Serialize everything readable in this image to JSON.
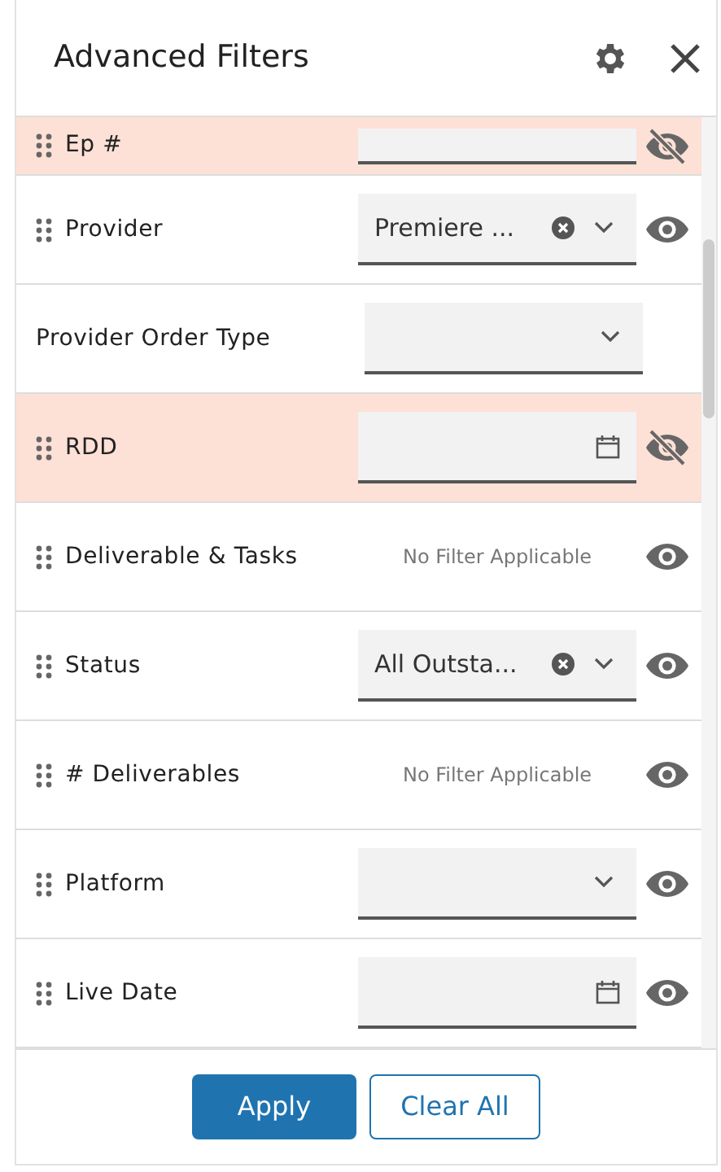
{
  "panel": {
    "title": "Advanced Filters"
  },
  "filters": [
    {
      "label": "Ep #",
      "draggable": true,
      "kind": "text",
      "hidden": true
    },
    {
      "label": "Provider",
      "draggable": true,
      "kind": "select",
      "value": "Premiere ...",
      "hidden": false
    },
    {
      "label": "Provider Order Type",
      "draggable": false,
      "kind": "select"
    },
    {
      "label": "RDD",
      "draggable": true,
      "kind": "date",
      "hidden": true
    },
    {
      "label": "Deliverable & Tasks",
      "draggable": true,
      "kind": "none",
      "note": "No Filter Applicable",
      "hidden": false
    },
    {
      "label": "Status",
      "draggable": true,
      "kind": "select",
      "value": "All Outsta...",
      "hidden": false
    },
    {
      "label": "# Deliverables",
      "draggable": true,
      "kind": "none",
      "note": "No Filter Applicable",
      "hidden": false
    },
    {
      "label": "Platform",
      "draggable": true,
      "kind": "select",
      "hidden": false
    },
    {
      "label": "Live Date",
      "draggable": true,
      "kind": "date",
      "hidden": false
    }
  ],
  "buttons": [
    {
      "label": "Apply",
      "kind": "primary"
    },
    {
      "label": "Clear All",
      "kind": "secondary"
    }
  ]
}
